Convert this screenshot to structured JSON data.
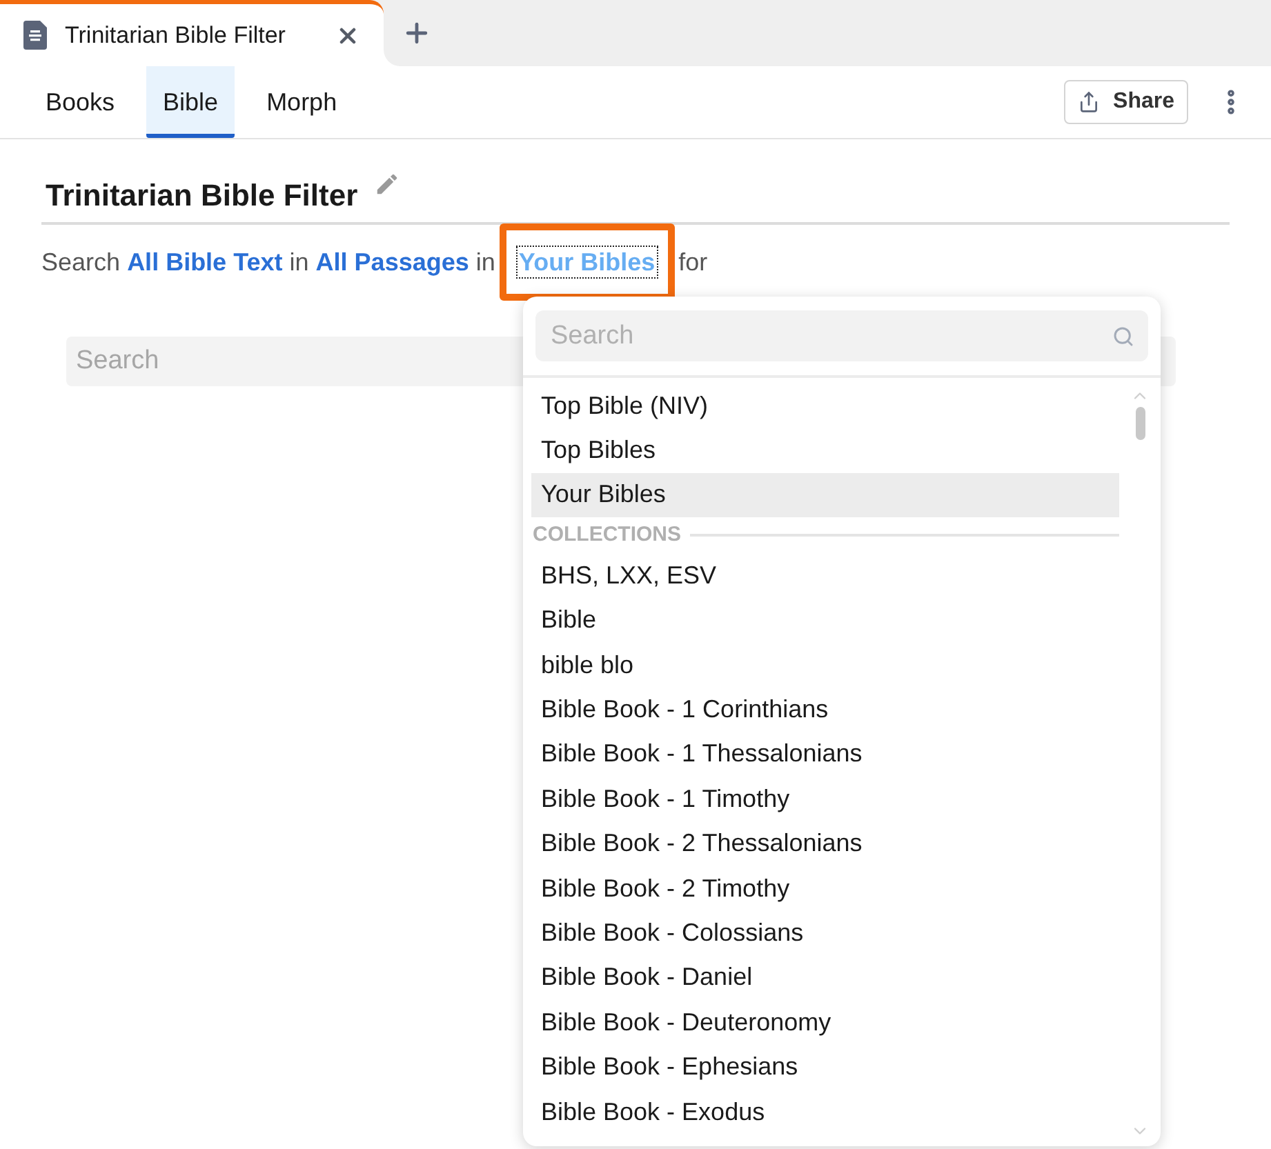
{
  "tab_strip": {
    "tabs": [
      {
        "title": "Trinitarian Bible Filter",
        "selected": true
      }
    ]
  },
  "toolbar": {
    "tabs": [
      {
        "label": "Books",
        "selected": false
      },
      {
        "label": "Bible",
        "selected": true
      },
      {
        "label": "Morph",
        "selected": false
      }
    ],
    "share_button": "Share"
  },
  "filter": {
    "title": "Trinitarian Bible Filter",
    "sentence": [
      {
        "kind": "text",
        "text": "Search"
      },
      {
        "kind": "link",
        "text": "All Bible Text",
        "open": false,
        "highlighted": false
      },
      {
        "kind": "text",
        "text": "in"
      },
      {
        "kind": "link",
        "text": "All Passages",
        "open": false,
        "highlighted": false
      },
      {
        "kind": "text",
        "text": "in"
      },
      {
        "kind": "link",
        "text": "Your Bibles",
        "open": true,
        "highlighted": true
      },
      {
        "kind": "text",
        "text": "for"
      }
    ],
    "search_field": {
      "placeholder": "Search"
    }
  },
  "dropdown": {
    "search_field": {
      "placeholder": "Search"
    },
    "items": [
      {
        "kind": "option",
        "label": "Top Bible (NIV)",
        "selected": false
      },
      {
        "kind": "option",
        "label": "Top Bibles",
        "selected": false
      },
      {
        "kind": "option",
        "label": "Your Bibles",
        "selected": true
      },
      {
        "kind": "header",
        "label": "COLLECTIONS"
      },
      {
        "kind": "option",
        "label": "BHS, LXX, ESV",
        "selected": false
      },
      {
        "kind": "option",
        "label": "Bible",
        "selected": false
      },
      {
        "kind": "option",
        "label": "bible blo",
        "selected": false
      },
      {
        "kind": "option",
        "label": "Bible Book - 1 Corinthians",
        "selected": false
      },
      {
        "kind": "option",
        "label": "Bible Book - 1 Thessalonians",
        "selected": false
      },
      {
        "kind": "option",
        "label": "Bible Book - 1 Timothy",
        "selected": false
      },
      {
        "kind": "option",
        "label": "Bible Book - 2 Thessalonians",
        "selected": false
      },
      {
        "kind": "option",
        "label": "Bible Book - 2 Timothy",
        "selected": false
      },
      {
        "kind": "option",
        "label": "Bible Book - Colossians",
        "selected": false
      },
      {
        "kind": "option",
        "label": "Bible Book - Daniel",
        "selected": false
      },
      {
        "kind": "option",
        "label": "Bible Book - Deuteronomy",
        "selected": false
      },
      {
        "kind": "option",
        "label": "Bible Book - Ephesians",
        "selected": false
      },
      {
        "kind": "option",
        "label": "Bible Book - Exodus",
        "selected": false
      }
    ]
  }
}
